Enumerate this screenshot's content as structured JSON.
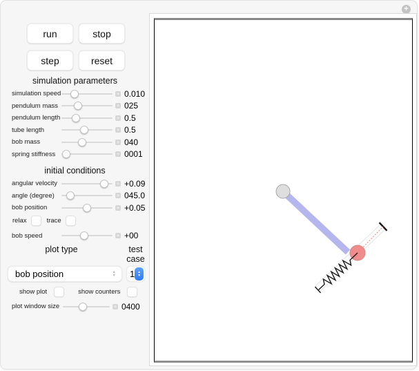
{
  "titlebar": {
    "expand_all_label": "+"
  },
  "icons": {
    "plus": "+",
    "chevron_up": "▲",
    "chevron_down": "▼"
  },
  "buttons": [
    {
      "label": "run"
    },
    {
      "label": "stop"
    },
    {
      "label": "step"
    },
    {
      "label": "reset"
    }
  ],
  "sim": {
    "title": "simulation parameters",
    "sliders": [
      {
        "label": "simulation speed",
        "value": "0.010",
        "frac": 0.25
      },
      {
        "label": "pendulum mass",
        "value": "025",
        "frac": 0.32
      },
      {
        "label": "pendulum length",
        "value": "0.5",
        "frac": 0.28
      },
      {
        "label": "tube length",
        "value": "0.5",
        "frac": 0.45
      },
      {
        "label": "bob mass",
        "value": "040",
        "frac": 0.41
      },
      {
        "label": "spring stiffness",
        "value": "0001",
        "frac": 0.1
      }
    ]
  },
  "ic": {
    "title": "initial conditions",
    "sliders": [
      {
        "label": "angular velocity",
        "value": "+0.09",
        "frac": 0.84
      },
      {
        "label": "angle (degree)",
        "value": "045.0",
        "frac": 0.17
      },
      {
        "label": "bob position",
        "value": "+0.05",
        "frac": 0.5
      }
    ],
    "relax": {
      "label": "relax",
      "checked": false
    },
    "trace": {
      "label": "trace",
      "checked": false
    },
    "bob_speed": {
      "label": "bob speed",
      "value": "+00",
      "frac": 0.45
    }
  },
  "plot": {
    "type_title": "plot type",
    "case_title": "test case",
    "type_value": "bob position",
    "case_value": "1",
    "show_plot": {
      "label": "show plot",
      "checked": false
    },
    "show_counters": {
      "label": "show counters",
      "checked": false
    },
    "window_size": {
      "label": "plot window size",
      "value": "0400",
      "frac": 0.42
    }
  },
  "canvas": {
    "colors": {
      "rod": "#b6b6ee",
      "pivot": "#dedede",
      "pivot_edge": "#a6a6a6",
      "bob": "#f08080",
      "bob_edge": "#d18989",
      "spring": "#1a1a1a",
      "tube_outline": "#e3e3e3",
      "end_cap": "#1a1a1a",
      "guide_line": "#f08080"
    }
  }
}
